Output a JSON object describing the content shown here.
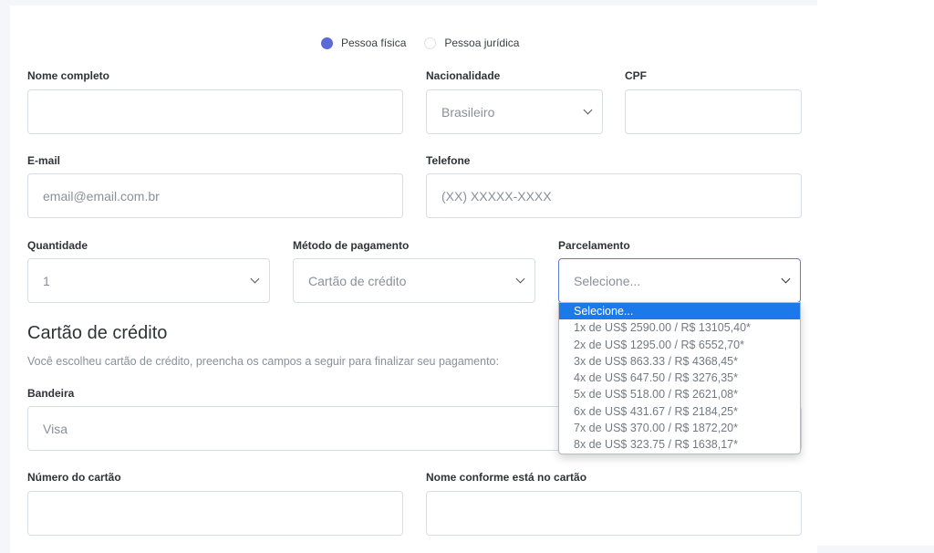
{
  "person_type": {
    "options": [
      {
        "label": "Pessoa física",
        "selected": true
      },
      {
        "label": "Pessoa jurídica",
        "selected": false
      }
    ]
  },
  "form": {
    "nome": {
      "label": "Nome completo",
      "value": ""
    },
    "nacionalidade": {
      "label": "Nacionalidade",
      "value": "Brasileiro"
    },
    "cpf": {
      "label": "CPF",
      "value": ""
    },
    "email": {
      "label": "E-mail",
      "placeholder": "email@email.com.br"
    },
    "telefone": {
      "label": "Telefone",
      "placeholder": "(XX) XXXXX-XXXX"
    },
    "quantidade": {
      "label": "Quantidade",
      "value": "1"
    },
    "metodo": {
      "label": "Método de pagamento",
      "value": "Cartão de crédito"
    },
    "parcelamento": {
      "label": "Parcelamento",
      "value": "Selecione...",
      "options": [
        "Selecione...",
        "1x de US$ 2590.00 / R$ 13105,40*",
        "2x de US$ 1295.00 / R$ 6552,70*",
        "3x de US$ 863.33 / R$ 4368,45*",
        "4x de US$ 647.50 / R$ 3276,35*",
        "5x de US$ 518.00 / R$ 2621,08*",
        "6x de US$ 431.67 / R$ 2184,25*",
        "7x de US$ 370.00 / R$ 1872,20*",
        "8x de US$ 323.75 / R$ 1638,17*"
      ],
      "highlighted_index": 0
    }
  },
  "credit_card": {
    "title": "Cartão de crédito",
    "description": "Você escolheu cartão de crédito, preencha os campos a seguir para finalizar seu pagamento:",
    "bandeira": {
      "label": "Bandeira",
      "value": "Visa"
    },
    "numero": {
      "label": "Número do cartão",
      "value": ""
    },
    "nome_cartao": {
      "label": "Nome conforme está no cartão",
      "value": ""
    }
  },
  "colors": {
    "accent": "#5b6ad7",
    "highlight": "#1c79e9"
  }
}
